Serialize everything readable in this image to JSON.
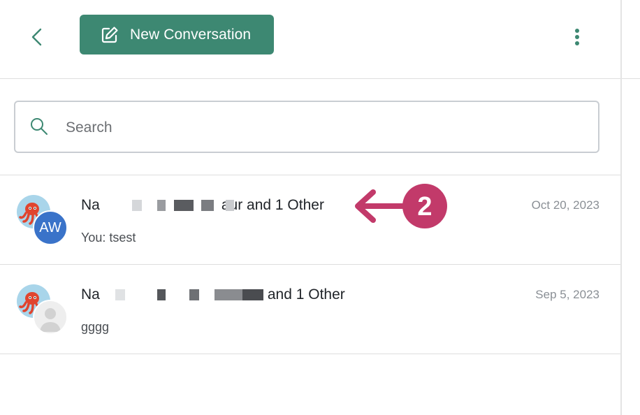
{
  "header": {
    "new_button_label": "New Conversation",
    "back_icon": "chevron-left-icon",
    "more_icon": "kebab-menu-icon",
    "accent_color": "#3d8872"
  },
  "search": {
    "placeholder": "Search",
    "value": ""
  },
  "conversations": [
    {
      "title_start": "Na",
      "title_end": "aur and 1 Other",
      "date": "Oct 20, 2023",
      "preview": "You:  tsest",
      "avatar_initials": "AW"
    },
    {
      "title_start": "Na",
      "title_end": "and 1 Other",
      "date": "Sep 5, 2023",
      "preview": "gggg",
      "avatar_initials": ""
    }
  ],
  "annotation": {
    "step_number": "2",
    "color": "#c23a6a"
  }
}
